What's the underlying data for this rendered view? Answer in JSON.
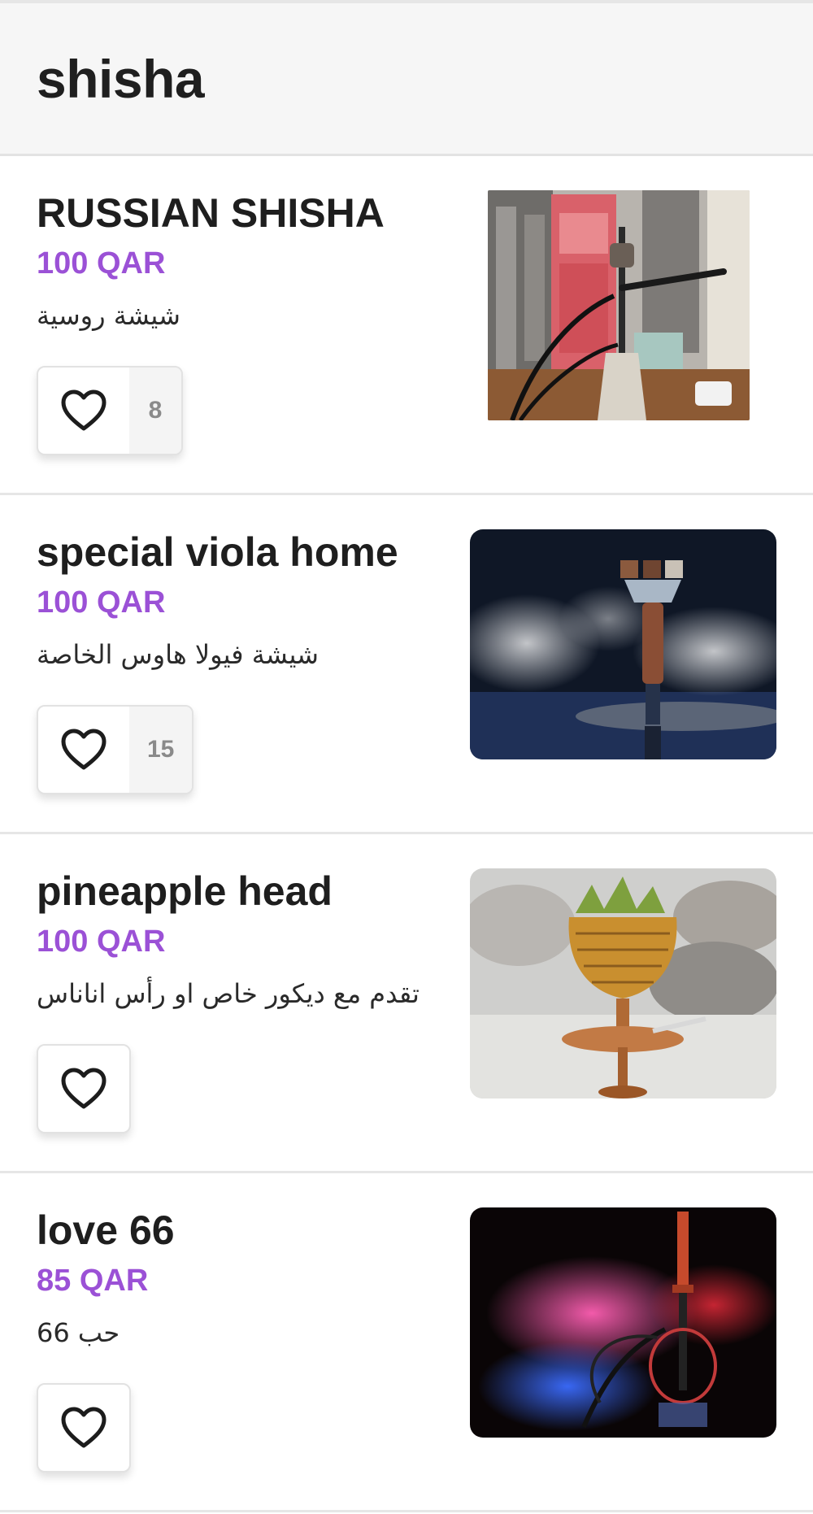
{
  "category": {
    "title": "shisha"
  },
  "items": [
    {
      "name": "RUSSIAN SHISHA",
      "price": "100 QAR",
      "description": "شيشة روسية",
      "likes": "8",
      "image_icon": "hookah-photo"
    },
    {
      "name": "special viola home",
      "price": "100 QAR",
      "description": "شيشة فيولا هاوس الخاصة",
      "likes": "15",
      "image_icon": "hookah-smoke-photo"
    },
    {
      "name": "pineapple head",
      "price": "100 QAR",
      "description": "تقدم مع ديكور خاص او رأس اناناس",
      "likes": "",
      "image_icon": "pineapple-hookah-photo"
    },
    {
      "name": "love 66",
      "price": "85 QAR",
      "description": "حب 66",
      "likes": "",
      "image_icon": "neon-smoke-hookah-photo"
    }
  ],
  "colors": {
    "price": "#9b51d6",
    "header_bg": "#f6f6f6",
    "divider": "#e6e6e6"
  },
  "icons": {
    "like": "heart-outline-icon"
  }
}
